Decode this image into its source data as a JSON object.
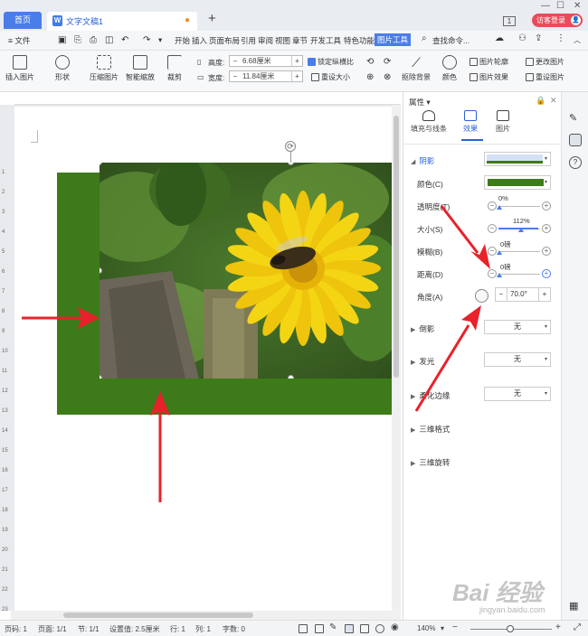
{
  "titlebar": {
    "home_tab": "首页",
    "doc_icon": "W",
    "doc_tab": "文字文稿1",
    "unsaved_dot": "●",
    "new_tab": "+",
    "badge": "1",
    "login": "访客登录",
    "avatar": "👤"
  },
  "menubar": {
    "file": "≡ 文件",
    "items": [
      "开始",
      "插入",
      "页面布局",
      "引用",
      "审阅",
      "视图",
      "章节",
      "开发工具",
      "特色功能",
      "图片工具"
    ],
    "search": "查找命令..."
  },
  "ribbon": {
    "insert_image": "插入图片",
    "shape": "形状",
    "compress": "压缩图片",
    "smart_zoom": "智能缩放",
    "crop": "裁剪",
    "height_label": "高度:",
    "height_value": "6.68厘米",
    "width_label": "宽度:",
    "width_value": "11.84厘米",
    "lock_ratio": "锁定纵横比",
    "reset_size": "重设大小",
    "remove_bg": "抠除背景",
    "color": "颜色",
    "outline": "图片轮廓",
    "effects": "图片效果",
    "change_image": "更改图片",
    "reset_image": "重设图片"
  },
  "ruler_numbers": [
    "1",
    "2",
    "3",
    "4",
    "5",
    "6",
    "7",
    "8",
    "9",
    "10",
    "11",
    "12",
    "13",
    "14",
    "15",
    "16",
    "17",
    "18",
    "19",
    "20",
    "21",
    "22",
    "23",
    "24",
    "25"
  ],
  "panel": {
    "title": "属性",
    "tabs": [
      "填充与线条",
      "效果",
      "图片"
    ],
    "shadow_section": "阴影",
    "color_label": "颜色(C)",
    "shadow_color": "#3d7a19",
    "transparency_label": "透明度(T)",
    "transparency_value": "0%",
    "size_label": "大小(S)",
    "size_value": "112%",
    "blur_label": "模糊(B)",
    "blur_value": "0磅",
    "distance_label": "距离(D)",
    "distance_value": "0磅",
    "angle_label": "角度(A)",
    "angle_value": "70.0°",
    "reflection": "倒影",
    "reflection_value": "无",
    "glow": "发光",
    "glow_value": "无",
    "soft_edge": "柔化边缘",
    "soft_edge_value": "无",
    "format3d": "三维格式",
    "rotation3d": "三维旋转"
  },
  "status": {
    "page": "页码: 1",
    "pages": "页面: 1/1",
    "section": "节: 1/1",
    "setting": "设置值: 2.5厘米",
    "row": "行: 1",
    "col": "列: 1",
    "words": "字数: 0",
    "zoom": "140%"
  },
  "watermark": "Bai 经验",
  "watermark_sub": "jingyan.baidu.com",
  "colors": {
    "accent": "#4a7de8",
    "shadow_green": "#3d7a19",
    "arrow_red": "#e8222a",
    "login_red": "#e74c5b"
  }
}
